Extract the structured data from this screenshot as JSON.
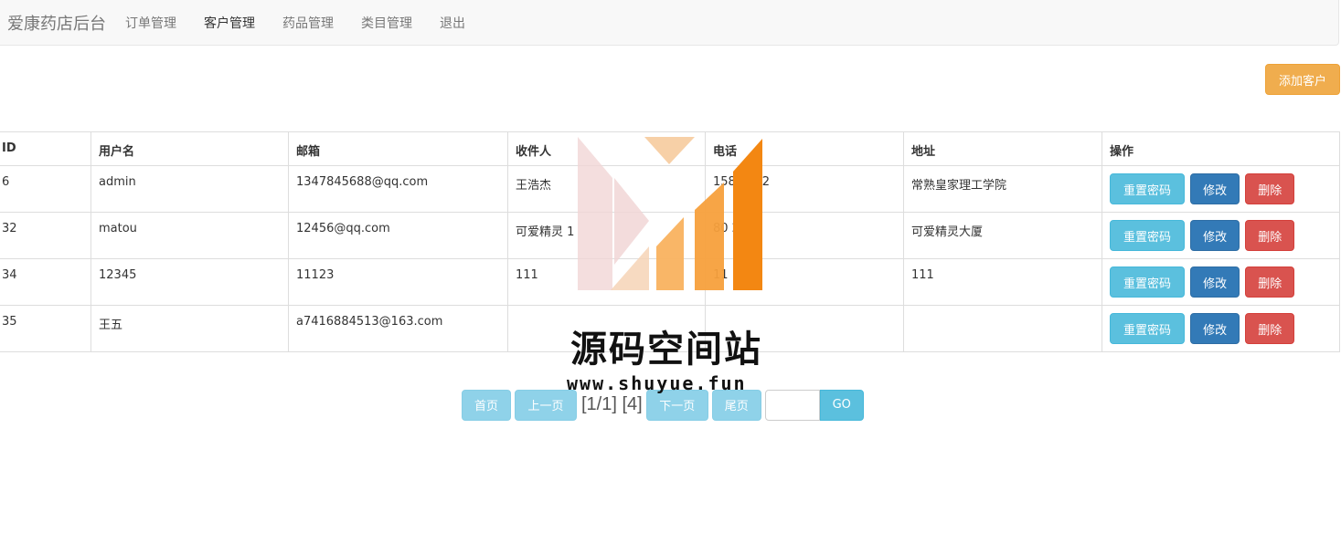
{
  "nav": {
    "brand": "爱康药店后台",
    "items": [
      {
        "label": "订单管理",
        "active": false
      },
      {
        "label": "客户管理",
        "active": true
      },
      {
        "label": "药品管理",
        "active": false
      },
      {
        "label": "类目管理",
        "active": false
      },
      {
        "label": "退出",
        "active": false
      }
    ]
  },
  "toolbar": {
    "add_label": "添加客户"
  },
  "table": {
    "headers": [
      "ID",
      "用户名",
      "邮箱",
      "收件人",
      "电话",
      "地址",
      "操作"
    ],
    "rows": [
      {
        "id": "6",
        "username": "admin",
        "email": "1347845688@qq.com",
        "recipient": "王浩杰",
        "phone": "158    9162",
        "address": "常熟皇家理工学院"
      },
      {
        "id": "32",
        "username": "matou",
        "email": "12456@qq.com",
        "recipient": "可爱精灵 1",
        "phone": "80    2404",
        "address": "可爱精灵大厦"
      },
      {
        "id": "34",
        "username": "12345",
        "email": "11123",
        "recipient": "111",
        "phone": "11",
        "address": "111"
      },
      {
        "id": "35",
        "username": "王五",
        "email": "a7416884513@163.com",
        "recipient": "",
        "phone": "",
        "address": ""
      }
    ],
    "actions": {
      "reset": "重置密码",
      "edit": "修改",
      "delete": "删除"
    }
  },
  "pager": {
    "first": "首页",
    "prev": "上一页",
    "info": "[1/1] [4]",
    "next": "下一页",
    "last": "尾页",
    "go": "GO"
  },
  "watermark": {
    "title": "源码空间站",
    "url": "www.shuyue.fun"
  },
  "colors": {
    "warning": "#f0ad4e",
    "info": "#5bc0de",
    "primary": "#337ab7",
    "danger": "#d9534f"
  }
}
